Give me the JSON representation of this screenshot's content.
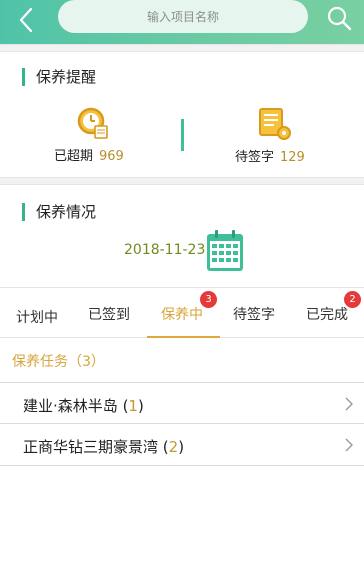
{
  "header": {
    "search_placeholder": "输入项目名称"
  },
  "reminder": {
    "title": "保养提醒",
    "overdue_label": "已超期",
    "overdue_count": "969",
    "to_sign_label": "待签字",
    "to_sign_count": "129"
  },
  "status": {
    "title": "保养情况",
    "date": "2018-11-23"
  },
  "tabs": [
    {
      "label": "计划中"
    },
    {
      "label": "已签到"
    },
    {
      "label": "保养中",
      "badge": "3"
    },
    {
      "label": "待签字"
    },
    {
      "label": "已完成",
      "badge": "2"
    }
  ],
  "tasks": {
    "header": "保养任务（3）",
    "items": [
      {
        "name": "建业·森林半岛",
        "open": "(",
        "count": "1",
        "close": ")"
      },
      {
        "name": "正商华钻三期豪景湾",
        "open": "(",
        "count": "2",
        "close": ")"
      }
    ]
  },
  "colors": {
    "header_start": "#4fc3a8",
    "header_end": "#79d0a2",
    "accent_green": "#35b48c",
    "accent_gold": "#d7a53a",
    "badge_red": "#e53a3a"
  }
}
